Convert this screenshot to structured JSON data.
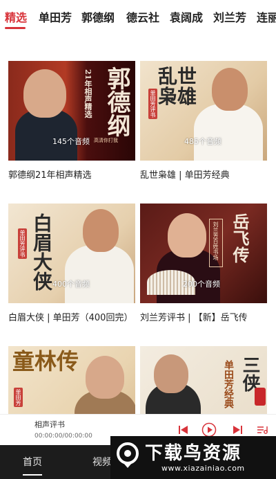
{
  "tabs": [
    {
      "label": "精选",
      "active": true
    },
    {
      "label": "单田芳",
      "active": false
    },
    {
      "label": "郭德纲",
      "active": false
    },
    {
      "label": "德云社",
      "active": false
    },
    {
      "label": "袁阔成",
      "active": false
    },
    {
      "label": "刘兰芳",
      "active": false
    },
    {
      "label": "连丽",
      "active": false
    }
  ],
  "cards": [
    {
      "title": "郭德纲21年相声精选",
      "count": "145个音频",
      "art_main": "郭德纲",
      "art_sub": "21年相声精选",
      "art_tag": "高清你打我"
    },
    {
      "title": "乱世枭雄 | 单田芳经典",
      "count": "485个音频",
      "art_main": "乱世枭雄",
      "art_tag": "单田芳评书"
    },
    {
      "title": "白眉大侠 | 单田芳（400回完）",
      "count": "400个音频",
      "art_main": "白眉大侠",
      "art_tag": "单田芳评书"
    },
    {
      "title": "刘兰芳评书 | 【新】岳飞传",
      "count": "200个音频",
      "art_main": "岳飞传",
      "art_tag": "刘兰芳百姓书场"
    },
    {
      "title": "",
      "count": "",
      "art_main": "童林传",
      "art_tag": "单田芳"
    },
    {
      "title": "",
      "count": "",
      "art_main": "三侠",
      "art_tag": "单田芳经典"
    }
  ],
  "player": {
    "title": "相声评书",
    "time": "00:00:00/00:00:00",
    "icons": [
      "prev-icon",
      "play-icon",
      "next-icon",
      "playlist-icon"
    ]
  },
  "nav": [
    {
      "label": "首页",
      "active": true
    },
    {
      "label": "视频",
      "active": false
    }
  ],
  "watermark": {
    "main": "下载鸟资源",
    "sub": "www.xiazainiao.com"
  },
  "colors": {
    "accent": "#d8333a",
    "nav_bg": "#1c1c1c"
  }
}
